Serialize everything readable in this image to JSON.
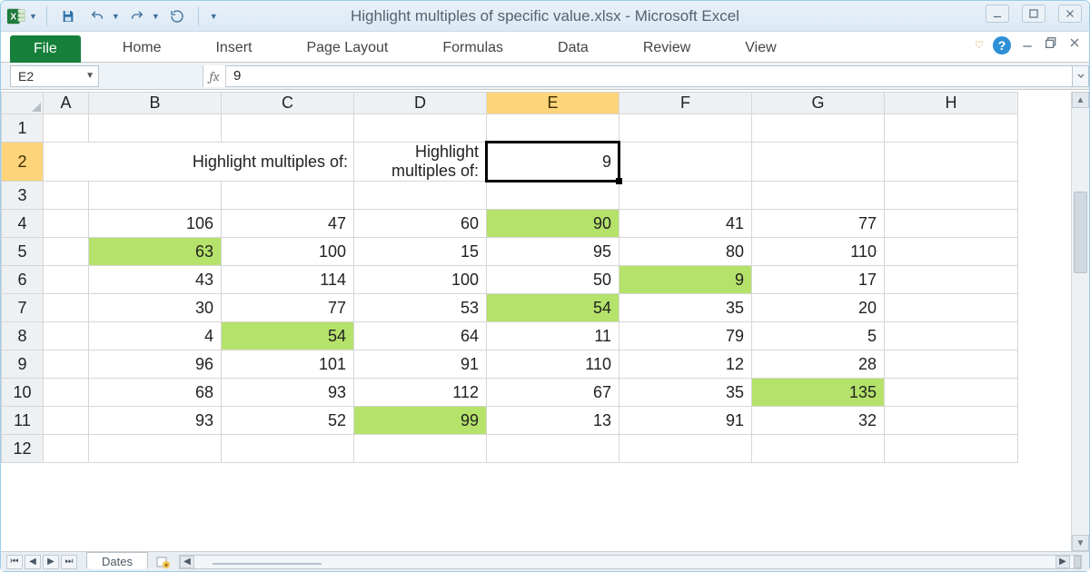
{
  "titlebar": {
    "title": "Highlight multiples of specific value.xlsx - Microsoft Excel"
  },
  "ribbon": {
    "file": "File",
    "tabs": [
      "Home",
      "Insert",
      "Page Layout",
      "Formulas",
      "Data",
      "Review",
      "View"
    ]
  },
  "formula_bar": {
    "namebox": "E2",
    "fx_label": "fx",
    "value": "9"
  },
  "grid": {
    "columns": [
      "A",
      "B",
      "C",
      "D",
      "E",
      "F",
      "G",
      "H"
    ],
    "selected_col": "E",
    "selected_row": 2,
    "active_cell": "E2",
    "row_count": 12,
    "label_text": "Highlight multiples of:",
    "input_value": "9",
    "data_start_row": 4,
    "data_cols": [
      "B",
      "C",
      "D",
      "E",
      "F",
      "G"
    ],
    "rows": [
      [
        106,
        47,
        60,
        90,
        41,
        77
      ],
      [
        63,
        100,
        15,
        95,
        80,
        110
      ],
      [
        43,
        114,
        100,
        50,
        9,
        17
      ],
      [
        30,
        77,
        53,
        54,
        35,
        20
      ],
      [
        4,
        54,
        64,
        11,
        79,
        5
      ],
      [
        96,
        101,
        91,
        110,
        12,
        28
      ],
      [
        68,
        93,
        112,
        67,
        35,
        135
      ],
      [
        93,
        52,
        99,
        13,
        91,
        32
      ]
    ],
    "highlight_divisor": 9
  },
  "bottombar": {
    "sheet_tab": "Dates"
  }
}
